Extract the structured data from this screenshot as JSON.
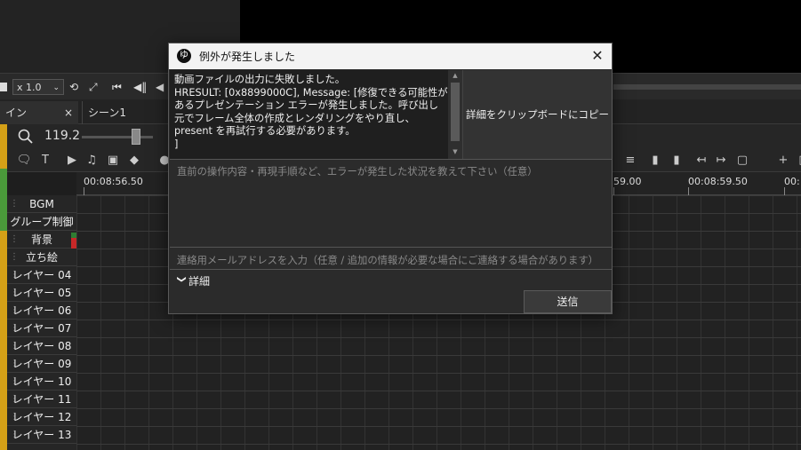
{
  "player": {
    "speed": "x 1.0"
  },
  "tabs": [
    {
      "label": "イン",
      "close": "×"
    },
    {
      "label": "シーン1"
    }
  ],
  "zoom": {
    "value": "119.2"
  },
  "ruler": {
    "labels": [
      "00:08:56.50",
      "59.00",
      "00:08:59.50",
      "00:"
    ]
  },
  "layers": [
    "BGM",
    "グループ制御",
    "背景",
    "立ち絵",
    "レイヤー 04",
    "レイヤー 05",
    "レイヤー 06",
    "レイヤー 07",
    "レイヤー 08",
    "レイヤー 09",
    "レイヤー 10",
    "レイヤー 11",
    "レイヤー 12",
    "レイヤー 13"
  ],
  "dialog": {
    "app_icon": "ゆ",
    "title": "例外が発生しました",
    "close": "✕",
    "message": "動画ファイルの出力に失敗しました。\nHRESULT: [0x8899000C], Message: [修復できる可能性があるプレゼンテーション エラーが発生しました。呼び出し元でフレーム全体の作成とレンダリングをやり直し、present を再試行する必要があります。\n]",
    "copy_button": "詳細をクリップボードにコピー",
    "repro_placeholder": "直前の操作内容・再現手順など、エラーが発生した状況を教えて下さい（任意）",
    "email_placeholder": "連絡用メールアドレスを入力（任意 / 追加の情報が必要な場合にご連絡する場合があります）",
    "details_label": "詳細",
    "send_button": "送信"
  },
  "colors": {
    "accent_stripe": "#d4a017",
    "dialog_bg": "#2b2b2b",
    "titlebar_bg": "#f3f3f3"
  }
}
